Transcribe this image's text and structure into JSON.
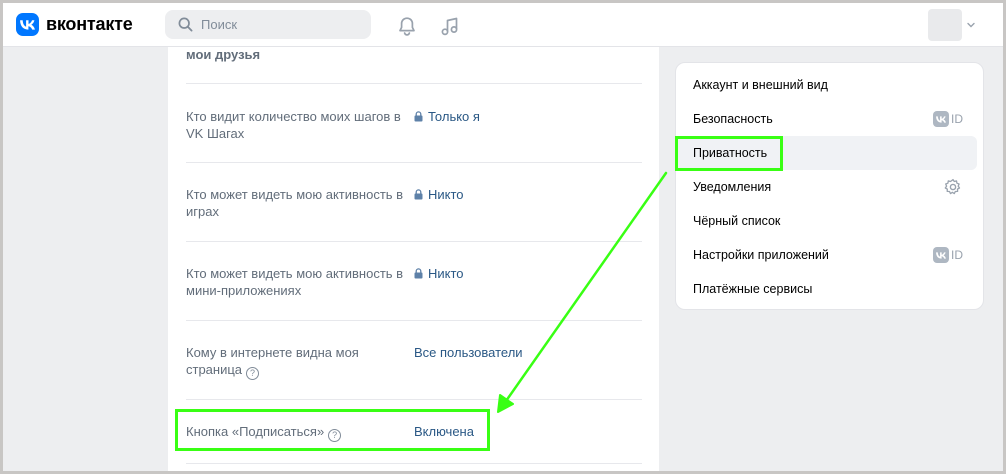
{
  "header": {
    "logo_text": "вконтакте",
    "search_placeholder": "Поиск"
  },
  "privacy": {
    "top_label": "мои друзья",
    "rows": [
      {
        "label": "Кто видит количество моих шагов в VK Шагах",
        "value": "Только я",
        "locked": true
      },
      {
        "label": "Кто может видеть мою активность в играх",
        "value": "Никто",
        "locked": true
      },
      {
        "label": "Кто может видеть мою активность в мини-приложениях",
        "value": "Никто",
        "locked": true
      },
      {
        "label": "Кому в интернете видна моя страница",
        "value": "Все пользователи",
        "locked": false,
        "help": true
      },
      {
        "label": "Кнопка «Подписаться»",
        "value": "Включена",
        "locked": false,
        "help": true
      }
    ]
  },
  "menu": {
    "items": [
      {
        "label": "Аккаунт и внешний вид"
      },
      {
        "label": "Безопасность",
        "badge": "ID"
      },
      {
        "label": "Приватность",
        "active": true
      },
      {
        "label": "Уведомления",
        "icon": "gear-icon"
      },
      {
        "label": "Чёрный список"
      },
      {
        "label": "Настройки приложений",
        "badge": "ID"
      },
      {
        "label": "Платёжные сервисы"
      }
    ]
  },
  "colors": {
    "accent": "#0077ff",
    "highlight": "#39ff14",
    "link": "#2a5885"
  }
}
